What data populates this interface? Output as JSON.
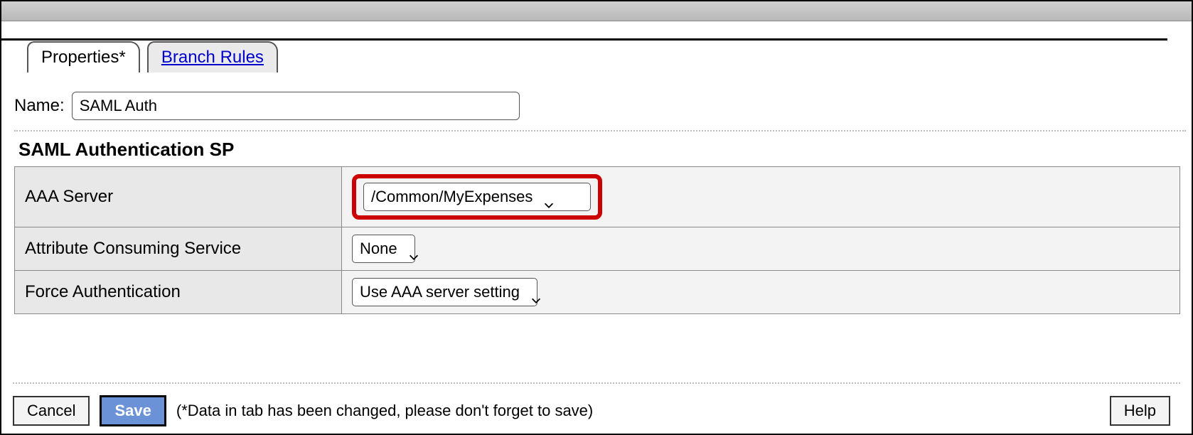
{
  "tabs": {
    "properties": "Properties*",
    "branch_rules": "Branch Rules"
  },
  "name_label": "Name:",
  "name_value": "SAML Auth",
  "section_title": "SAML Authentication SP",
  "rows": {
    "aaa_server": {
      "label": "AAA Server",
      "value": "/Common/MyExpenses"
    },
    "acs": {
      "label": "Attribute Consuming Service",
      "value": "None"
    },
    "force_auth": {
      "label": "Force Authentication",
      "value": "Use AAA server setting"
    }
  },
  "footer": {
    "cancel": "Cancel",
    "save": "Save",
    "message": "(*Data in tab has been changed, please don't forget to save)",
    "help": "Help"
  }
}
